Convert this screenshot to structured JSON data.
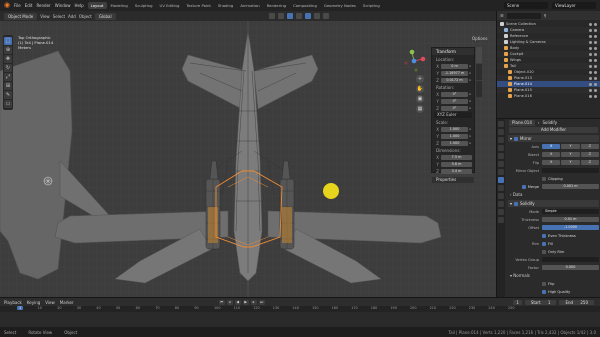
{
  "menubar": {
    "menus": [
      "File",
      "Edit",
      "Render",
      "Window",
      "Help"
    ],
    "workspaces": [
      "Layout",
      "Modeling",
      "Sculpting",
      "UV Editing",
      "Texture Paint",
      "Shading",
      "Animation",
      "Rendering",
      "Compositing",
      "Geometry Nodes",
      "Scripting"
    ],
    "active_workspace": "Layout",
    "scene": "Scene",
    "view_layer": "ViewLayer"
  },
  "viewport": {
    "header": {
      "mode": "Object Mode",
      "menus": [
        "View",
        "Select",
        "Add",
        "Object"
      ],
      "pivot": "Global"
    },
    "info": [
      "Top Orthographic",
      "(1) Tail | Plane.014",
      "Meters"
    ],
    "options_label": "Options",
    "npanel": {
      "transform_label": "Transform",
      "location_label": "Location:",
      "location": [
        "0 m",
        "-1.18977 m",
        "0.0172 m"
      ],
      "rotation_label": "Rotation:",
      "rotation": [
        "0°",
        "0°",
        "0°"
      ],
      "rotation_mode": "XYZ Euler",
      "scale_label": "Scale:",
      "scale": [
        "1.000",
        "1.000",
        "1.000"
      ],
      "dimensions_label": "Dimensions:",
      "dimensions": [
        "7.5 m",
        "5.6 m",
        "3.4 m"
      ],
      "properties_label": "Properties"
    }
  },
  "outliner": {
    "rows": [
      {
        "label": "Scene Collection",
        "color": "#cfcfcf",
        "selected": false
      },
      {
        "label": "Camera",
        "color": "#8fb5d9",
        "selected": false
      },
      {
        "label": "Reference",
        "color": "#cfcfcf",
        "selected": false
      },
      {
        "label": "Lighting & Cameras",
        "color": "#cfcfcf",
        "selected": false
      },
      {
        "label": "Body",
        "color": "#e6a24a",
        "selected": false
      },
      {
        "label": "Cockpit",
        "color": "#e6a24a",
        "selected": false
      },
      {
        "label": "Wings",
        "color": "#e6a24a",
        "selected": false
      },
      {
        "label": "Tail",
        "color": "#e6a24a",
        "selected": false
      },
      {
        "label": "Object.010",
        "color": "#e6a24a",
        "selected": false
      },
      {
        "label": "Plane.013",
        "color": "#e6a24a",
        "selected": false
      },
      {
        "label": "Plane.014",
        "color": "#e6a24a",
        "selected": true
      },
      {
        "label": "Plane.015",
        "color": "#e6a24a",
        "selected": false
      },
      {
        "label": "Plane.016",
        "color": "#e6a24a",
        "selected": false
      }
    ]
  },
  "properties": {
    "object_name": "Plane.014",
    "modifier_name": "Solidify",
    "add_modifier": "Add Modifier",
    "mirror": {
      "name": "Mirror",
      "axis_label": "Axis",
      "bisect_label": "Bisect",
      "flip_label": "Flip",
      "axes": [
        "X",
        "Y",
        "Z"
      ],
      "mirror_object_label": "Mirror Object",
      "clipping_label": "Clipping",
      "merge_label": "Merge",
      "merge_value": "0.001 m",
      "data_label": "Data"
    },
    "solidify": {
      "name": "Solidify",
      "mode_label": "Mode",
      "mode_value": "Simple",
      "thickness_label": "Thickness",
      "thickness_value": "0.01 m",
      "offset_label": "Offset",
      "offset_value": "-1.0000",
      "even_thickness": "Even Thickness",
      "rim_label": "Rim",
      "fill": "Fill",
      "only_rim": "Only Rim",
      "vertex_group_label": "Vertex Group",
      "factor_label": "Factor",
      "factor_value": "0.000",
      "normals_label": "Normals",
      "flip": "Flip",
      "high_quality": "High Quality"
    }
  },
  "timeline": {
    "menus": [
      "Playback",
      "Keying",
      "View",
      "Marker"
    ],
    "current_frame": "1",
    "start_label": "Start",
    "start": "1",
    "end_label": "End",
    "end": "250",
    "ruler": [
      "0",
      "10",
      "20",
      "30",
      "40",
      "50",
      "60",
      "70",
      "80",
      "90",
      "100",
      "110",
      "120",
      "130",
      "140",
      "150",
      "160",
      "170",
      "180",
      "190",
      "200",
      "210",
      "220",
      "230",
      "240",
      "250"
    ]
  },
  "statusbar": {
    "hints": [
      "Select",
      "Rotate View",
      "Object"
    ],
    "stats": "Tail | Plane.014 | Verts 1,220 | Faces 1,216 | Tris 2,432 | Objects 1/42 | 3.0"
  },
  "colors": {
    "accent": "#4772b3",
    "selection_outline": "#f08a32",
    "cursor_highlight": "#f5e11a",
    "viewport_bg": "#3d3d3d"
  }
}
